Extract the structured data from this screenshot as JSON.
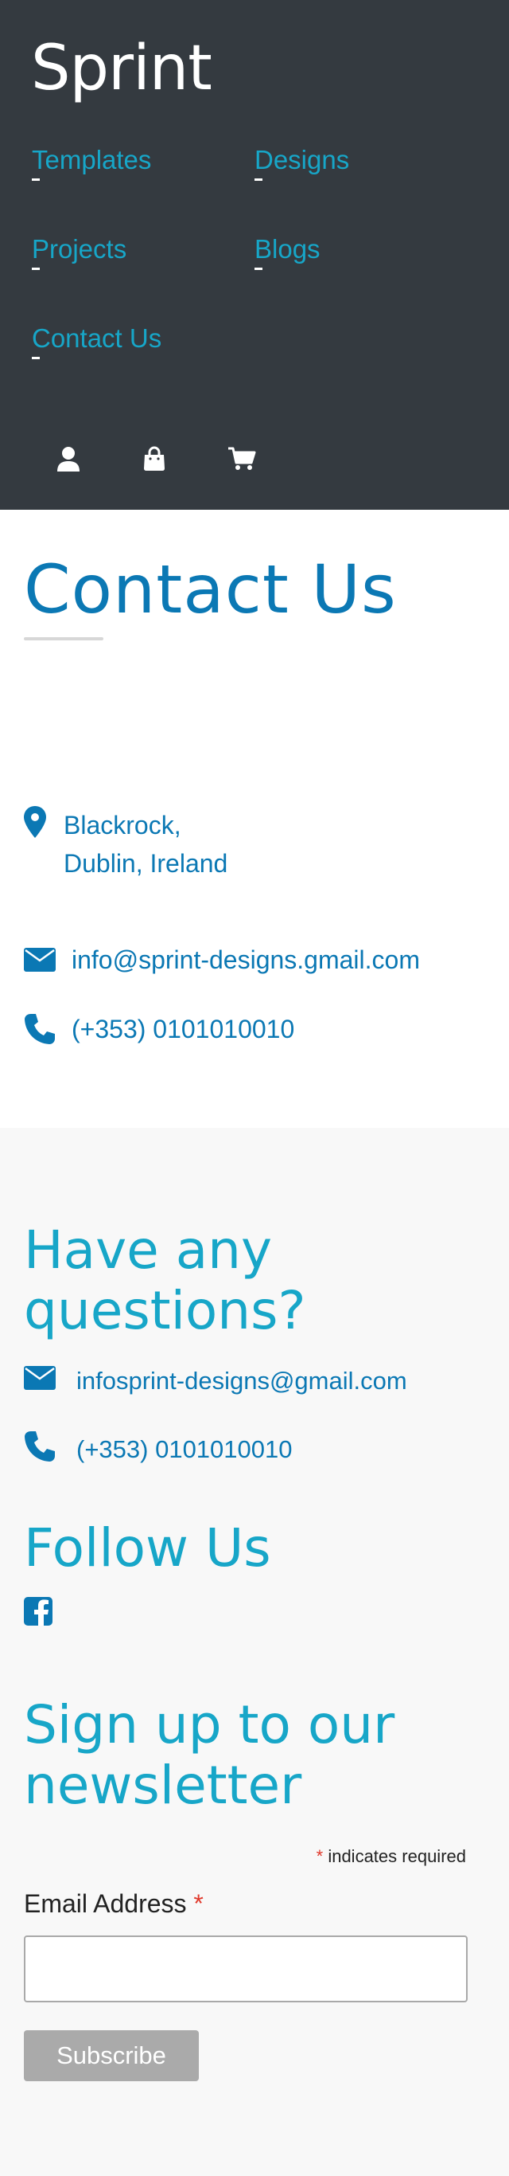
{
  "header": {
    "brand": "Sprint",
    "nav": [
      {
        "label": "Templates"
      },
      {
        "label": "Designs"
      },
      {
        "label": "Projects"
      },
      {
        "label": "Blogs"
      },
      {
        "label": "Contact Us"
      }
    ],
    "icons": [
      "user-icon",
      "shopping-bag-icon",
      "cart-icon"
    ]
  },
  "contact": {
    "title": "Contact Us",
    "address_line1": "Blackrock,",
    "address_line2": "Dublin, Ireland",
    "email": "info@sprint-designs.gmail.com",
    "phone": "(+353) 0101010010"
  },
  "questions": {
    "title_line1": "Have any",
    "title_line2": "questions?",
    "email": "infosprint-designs@gmail.com",
    "phone": "(+353) 0101010010"
  },
  "follow": {
    "title": "Follow Us",
    "icon": "facebook-icon"
  },
  "newsletter": {
    "title_line1": "Sign up to our",
    "title_line2": "newsletter",
    "required_star": "*",
    "required_note": "indicates required",
    "email_label": "Email Address",
    "email_value": "",
    "subscribe_label": "Subscribe"
  },
  "colors": {
    "header_bg": "#343a40",
    "link": "#17a6c8",
    "contact_blue": "#0b78b4",
    "required": "#e0392c",
    "button_bg": "#aaaaaa"
  }
}
